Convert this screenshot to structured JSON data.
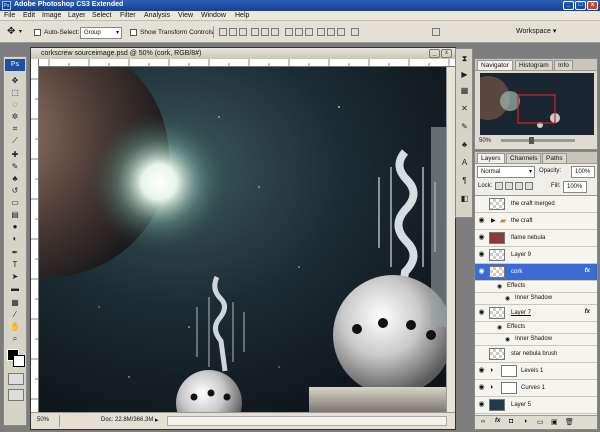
{
  "app": {
    "title": "Adobe Photoshop CS3 Extended",
    "badge": "Ps"
  },
  "menu": [
    "File",
    "Edit",
    "Image",
    "Layer",
    "Select",
    "Filter",
    "Analysis",
    "View",
    "Window",
    "Help"
  ],
  "options": {
    "auto_select_label": "Auto-Select:",
    "auto_select_value": "Group",
    "transform_label": "Show Transform Controls",
    "workspace_label": "Workspace ▾"
  },
  "document": {
    "title": "corkscrew sourceimage.psd @ 50% (cork, RGB/8#)",
    "zoom": "50%",
    "doc_info": "Doc: 22.8M/366.3M"
  },
  "navigator": {
    "tabs": [
      "Navigator",
      "Histogram",
      "Info"
    ],
    "zoom": "50%"
  },
  "layers": {
    "tabs": [
      "Layers",
      "Channels",
      "Paths"
    ],
    "blend_mode": "Normal",
    "opacity_label": "Opacity:",
    "opacity_value": "100%",
    "lock_label": "Lock:",
    "fill_label": "Fill:",
    "fill_value": "100%",
    "fx_label": "fx",
    "rows": [
      {
        "name": "the craft merged"
      },
      {
        "name": "the craft"
      },
      {
        "name": "flame nebula"
      },
      {
        "name": "Layer 9"
      },
      {
        "name": "cork"
      },
      {
        "name": "Effects"
      },
      {
        "name": "Inner Shadow"
      },
      {
        "name": "Layer 7"
      },
      {
        "name": "Effects"
      },
      {
        "name": "Inner Shadow"
      },
      {
        "name": "star nebula brush"
      },
      {
        "name": "Levels 1"
      },
      {
        "name": "Curves 1"
      },
      {
        "name": "Layer 5"
      }
    ]
  },
  "colors": {
    "accent": "#3a6cd4",
    "titlebar": "#1a3f8c"
  },
  "icons": {
    "move_tool": "move-icon",
    "eye": "eye-icon"
  }
}
